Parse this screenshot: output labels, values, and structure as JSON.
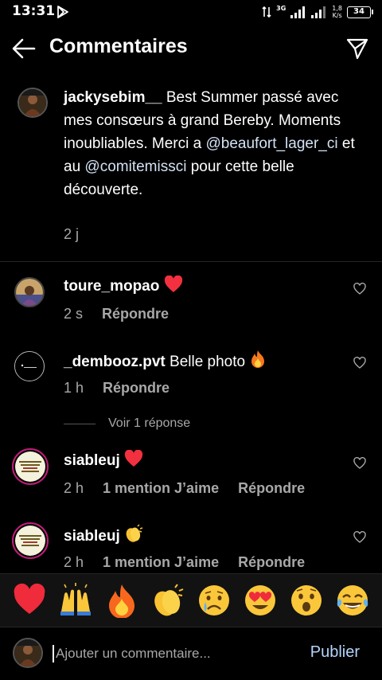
{
  "status_bar": {
    "time": "13:31",
    "network": "3G",
    "speed_value": "1,8",
    "speed_unit": "K/s",
    "battery": "34"
  },
  "header": {
    "title": "Commentaires"
  },
  "caption": {
    "username": "jackysebim__",
    "text_1": "Best Summer passé avec mes consœurs à grand Bereby. Moments inoubliables. Merci a ",
    "mention_1": "@beaufort_lager_ci",
    "text_2": " et au ",
    "mention_2": "@comitemissci",
    "text_3": " pour cette belle découverte.",
    "time": "2 j"
  },
  "comments": [
    {
      "username": "toure_mopao",
      "text": "",
      "emoji": "red-heart",
      "time": "2 s",
      "reply_label": "Répondre"
    },
    {
      "username": "_dembooz.pvt",
      "text": "Belle photo",
      "emoji": "fire",
      "time": "1 h",
      "reply_label": "Répondre"
    },
    {
      "username": "siableuj",
      "text": "",
      "emoji": "red-heart",
      "time": "2 h",
      "likes_label": "1 mention J’aime",
      "reply_label": "Répondre"
    },
    {
      "username": "siableuj",
      "text": "",
      "emoji": "clapping-hands",
      "time": "2 h",
      "likes_label": "1 mention J’aime",
      "reply_label": "Répondre"
    }
  ],
  "view_replies_label": "Voir 1 réponse",
  "emoji_bar": [
    "red-heart",
    "raising-hands",
    "fire",
    "clapping-hands",
    "crying-face",
    "heart-eyes-face",
    "astonished-face",
    "tears-of-joy-face"
  ],
  "composer": {
    "placeholder": "Ajouter un commentaire...",
    "publish_label": "Publier"
  },
  "colors": {
    "background": "#000000",
    "secondary_text": "#a8a8a8",
    "mention": "#d3e2f5",
    "publish": "#b3d4fc",
    "story_ring": "#c21d7b"
  }
}
